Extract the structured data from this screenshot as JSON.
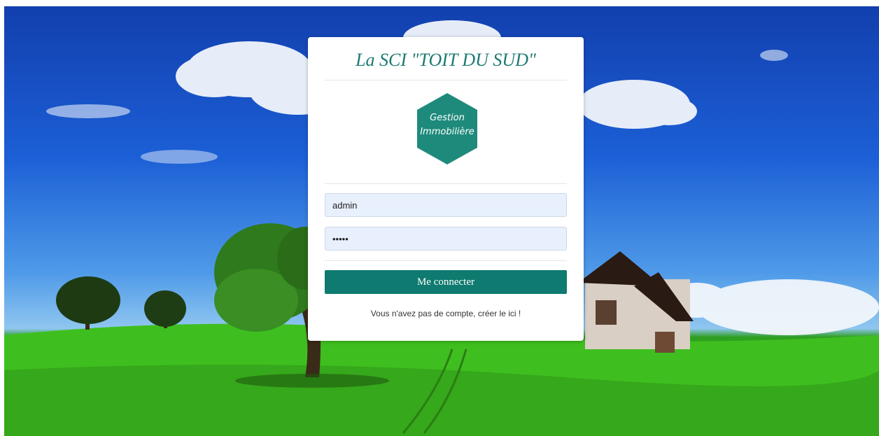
{
  "brand": {
    "title": "La SCI \"TOIT DU SUD\"",
    "logo_line1": "Gestion",
    "logo_line2": "Immobilière",
    "accent_color": "#0e7a70"
  },
  "login": {
    "username_value": "admin",
    "password_value": "*****",
    "submit_label": "Me connecter",
    "signup_text": "Vous n'avez pas de compte, créer le ici !"
  }
}
